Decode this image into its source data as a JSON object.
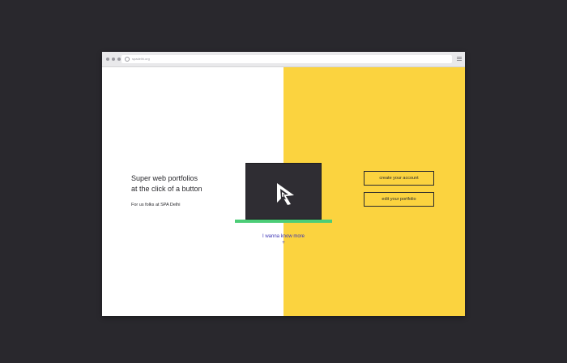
{
  "browser": {
    "url": "spadelhi.org",
    "icons": [
      "window-dots",
      "url-icon",
      "menu-icon"
    ]
  },
  "hero": {
    "headline": "Super web portfolios\nat the click of a button",
    "subline": "For us folks at SPA Delhi"
  },
  "illustration": {
    "logo": "spa-logo",
    "base_color": "#4ccd77"
  },
  "more": {
    "label": "I wanna know more",
    "plus": "+"
  },
  "actions": {
    "create_label": "create your account",
    "edit_label": "edit your portfolio"
  },
  "colors": {
    "background": "#29282d",
    "accent_yellow": "#fbd33f",
    "link_blue": "#3b33b5",
    "laptop_screen": "#2f2d33"
  }
}
